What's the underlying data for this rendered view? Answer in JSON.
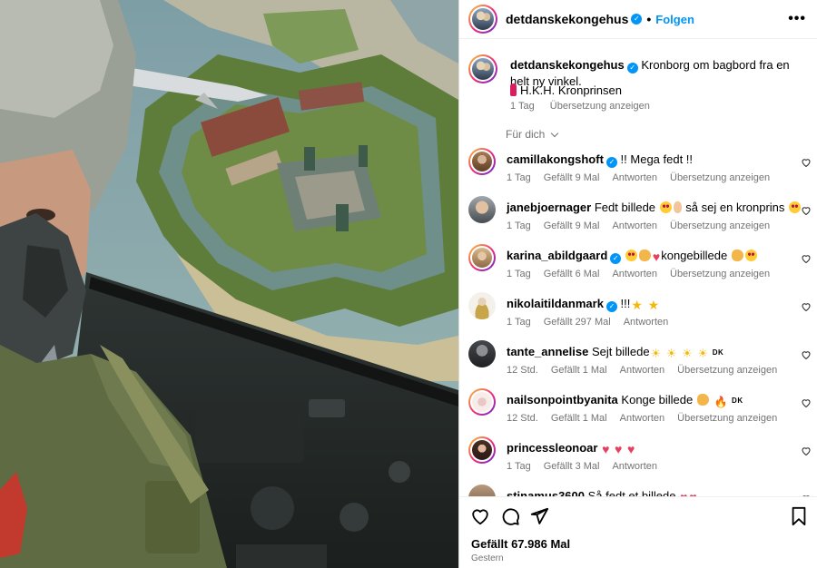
{
  "header": {
    "username": "detdanskekongehus",
    "follow_label": "Folgen",
    "more_icon": "more-dots-icon"
  },
  "caption": {
    "username": "detdanskekongehus",
    "text": "Kronborg om bagbord fra en helt ny vinkel.",
    "signature": "H.K.H. Kronprinsen",
    "time": "1 Tag",
    "translate": "Übersetzung anzeigen"
  },
  "for_you_label": "Für dich",
  "comments": [
    {
      "username": "camillakongshoft",
      "verified": true,
      "text": "!! Mega fedt !!",
      "time": "1 Tag",
      "likes": "Gefällt 9 Mal",
      "reply": "Antworten",
      "translate": "Übersetzung anzeigen"
    },
    {
      "username": "janebjoernager",
      "verified": false,
      "text_a": "Fedt billede",
      "text_b": "så sej en kronprins",
      "time": "1 Tag",
      "likes": "Gefällt 9 Mal",
      "reply": "Antworten",
      "translate": "Übersetzung anzeigen"
    },
    {
      "username": "karina_abildgaard",
      "verified": true,
      "text": "kongebillede",
      "time": "1 Tag",
      "likes": "Gefällt 6 Mal",
      "reply": "Antworten",
      "translate": "Übersetzung anzeigen"
    },
    {
      "username": "nikolaitildanmark",
      "verified": true,
      "text": "!!!",
      "time": "1 Tag",
      "likes": "Gefällt 297 Mal",
      "reply": "Antworten"
    },
    {
      "username": "tante_annelise",
      "verified": false,
      "text": "Sejt billede",
      "flag": "DK",
      "time": "12 Std.",
      "likes": "Gefällt 1 Mal",
      "reply": "Antworten",
      "translate": "Übersetzung anzeigen"
    },
    {
      "username": "nailsonpointbyanita",
      "verified": false,
      "text": "Konge billede",
      "flag": "DK",
      "time": "12 Std.",
      "likes": "Gefällt 1 Mal",
      "reply": "Antworten",
      "translate": "Übersetzung anzeigen"
    },
    {
      "username": "princessleonoar",
      "verified": false,
      "time": "1 Tag",
      "likes": "Gefällt 3 Mal",
      "reply": "Antworten"
    },
    {
      "username": "stinamus3600",
      "verified": false,
      "text": "Så fedt et billede"
    }
  ],
  "footer": {
    "likes": "Gefällt 67.986 Mal",
    "time": "Gestern"
  },
  "icons": {
    "like": "heart-icon",
    "comment": "comment-icon",
    "share": "share-icon",
    "save": "bookmark-icon"
  },
  "colors": {
    "accent": "#0095f6",
    "secondary_text": "#737373",
    "border": "#dbdbdb"
  }
}
